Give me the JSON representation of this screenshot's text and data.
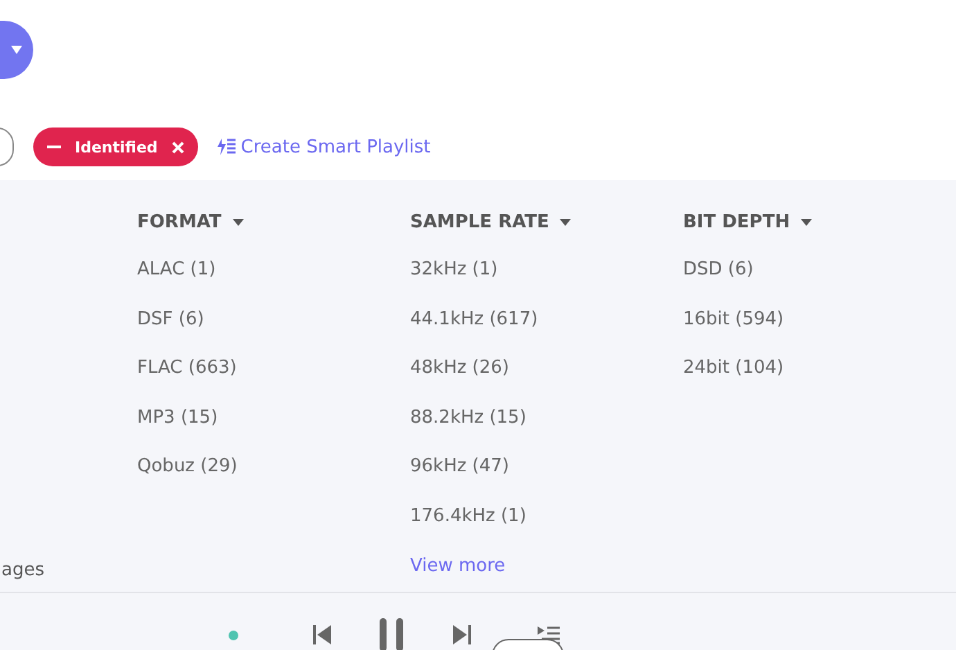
{
  "filters": {
    "chip": {
      "label": "Identified"
    },
    "link": {
      "label": "Create Smart Playlist"
    }
  },
  "columns": [
    {
      "heading": "FORMAT",
      "items": [
        "ALAC (1)",
        "DSF (6)",
        "FLAC (663)",
        "MP3 (15)",
        "Qobuz (29)"
      ]
    },
    {
      "heading": "SAMPLE RATE",
      "items": [
        "32kHz (1)",
        "44.1kHz (617)",
        "48kHz (26)",
        "88.2kHz (15)",
        "96kHz (47)",
        "176.4kHz (1)"
      ],
      "more": "View more"
    },
    {
      "heading": "BIT DEPTH",
      "items": [
        "DSD (6)",
        "16bit (594)",
        "24bit (104)"
      ]
    }
  ],
  "side_label": "ages",
  "player": {
    "playing": true
  }
}
